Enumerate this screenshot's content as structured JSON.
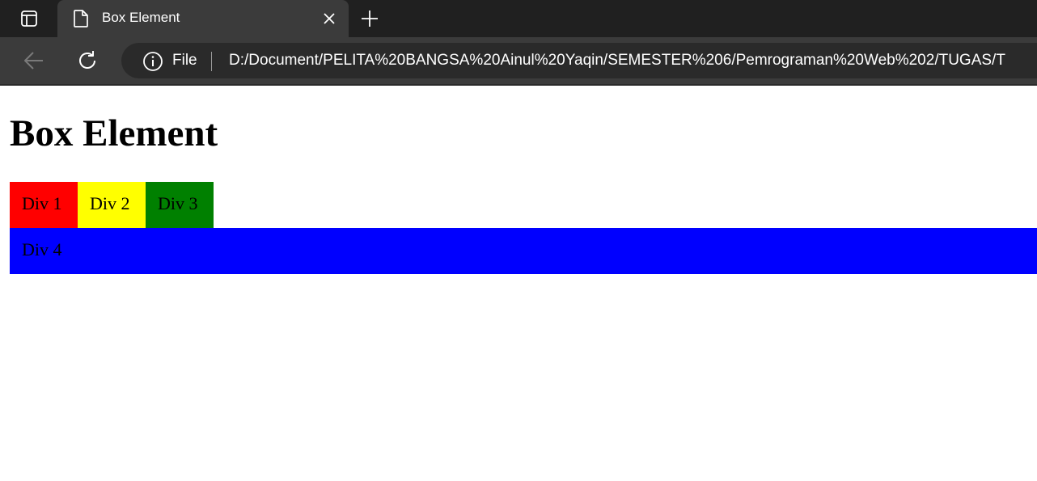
{
  "browser": {
    "tab": {
      "title": "Box Element",
      "icon": "document-icon",
      "close_icon": "close-icon"
    },
    "new_tab_icon": "plus-icon",
    "sidebar_toggle_icon": "sidebar-icon",
    "toolbar": {
      "back_icon": "arrow-left-icon",
      "reload_icon": "reload-icon",
      "site_info_icon": "info-icon",
      "site_label": "File",
      "url": "D:/Document/PELITA%20BANGSA%20Ainul%20Yaqin/SEMESTER%206/Pemrograman%20Web%202/TUGAS/T"
    },
    "colors": {
      "tabstrip": "#202020",
      "toolbar": "#3b3b3b",
      "omnibox": "#2a2a2a"
    }
  },
  "page": {
    "heading": "Box Element",
    "boxes": [
      {
        "label": "Div 1",
        "color": "#ff0000"
      },
      {
        "label": "Div 2",
        "color": "#ffff00"
      },
      {
        "label": "Div 3",
        "color": "#008000"
      },
      {
        "label": "Div 4",
        "color": "#0000ff"
      }
    ]
  }
}
